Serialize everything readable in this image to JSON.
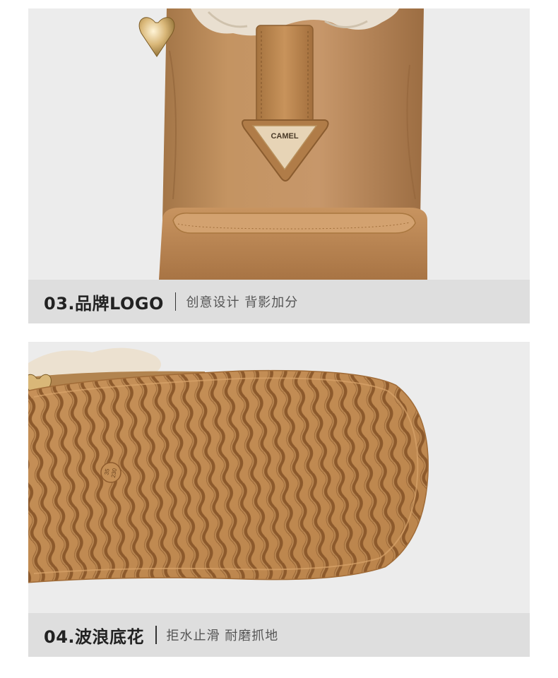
{
  "sections": [
    {
      "title": "03.品牌LOGO",
      "subtitle": "创意设计 背影加分",
      "logo_label": "CAMEL"
    },
    {
      "title": "04.波浪底花",
      "subtitle": "拒水止滑  耐磨抓地",
      "size_mark_top": "35",
      "size_mark_bottom": "230"
    }
  ],
  "colors": {
    "panel_bg": "#ececec",
    "caption_bg": "#dedede",
    "suede": "#b98a57",
    "sole": "#c48f56"
  }
}
